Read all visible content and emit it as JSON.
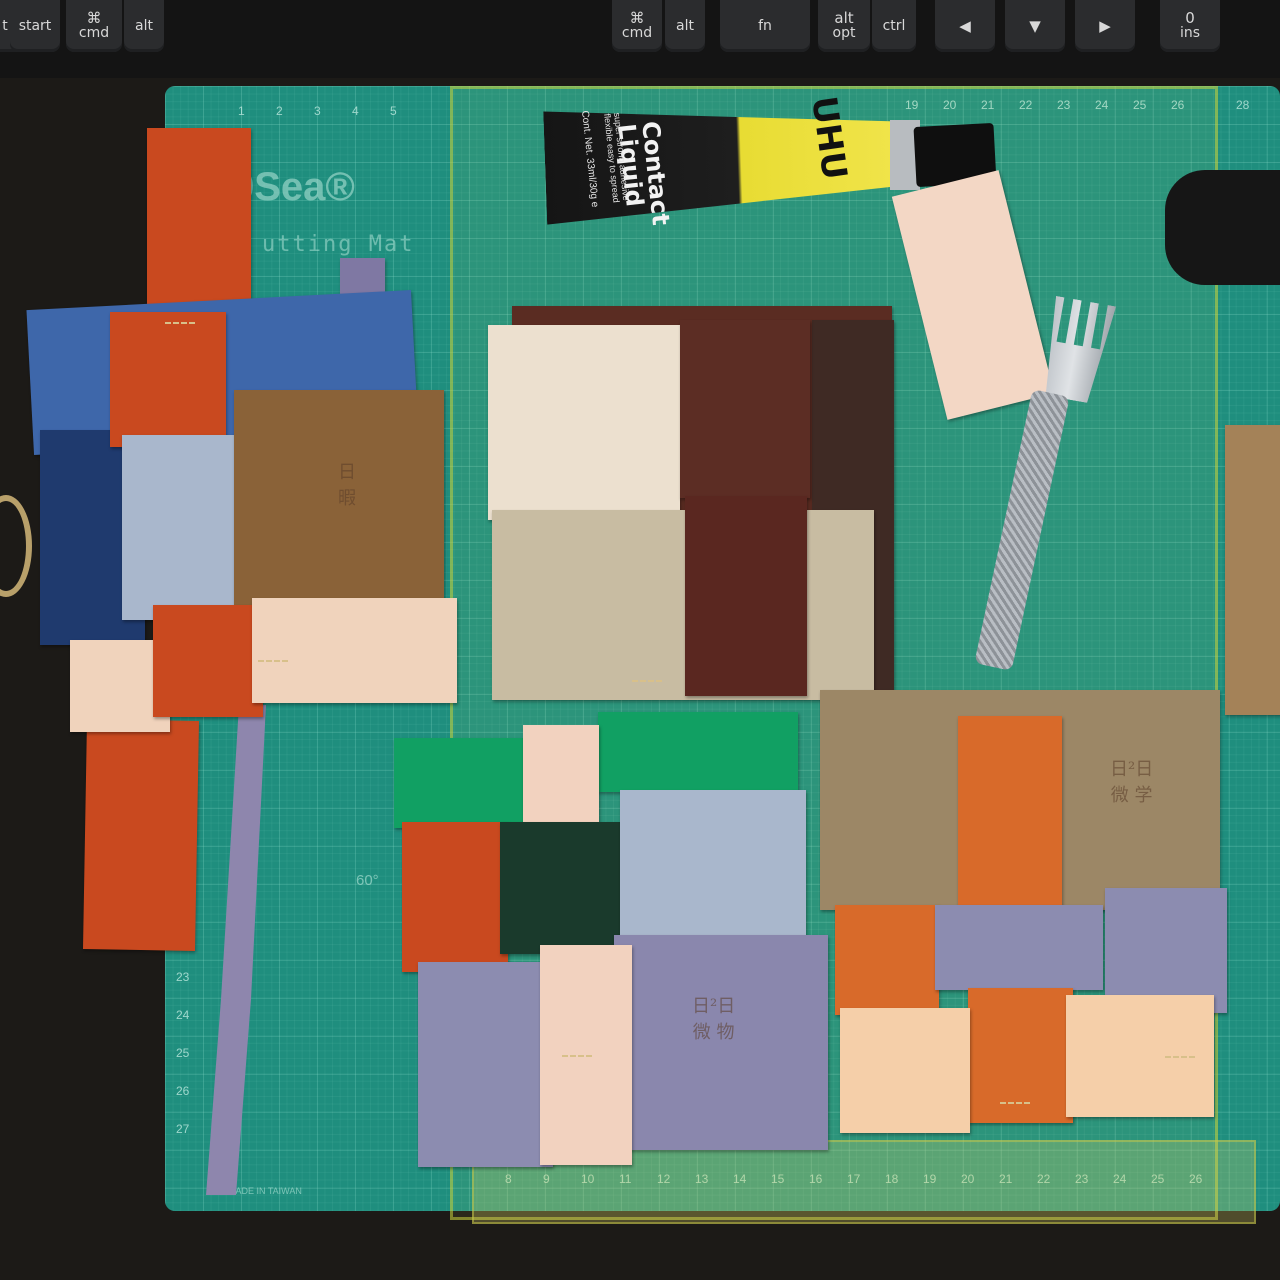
{
  "keyboard": {
    "keys": [
      {
        "id": "key-cut-left",
        "glyph": "",
        "label": "t"
      },
      {
        "id": "key-start",
        "glyph": "",
        "label": "start"
      },
      {
        "id": "key-cmd-left",
        "glyph": "⌘",
        "label": "cmd"
      },
      {
        "id": "key-alt-left",
        "glyph": "",
        "label": "alt"
      },
      {
        "id": "key-cmd-right",
        "glyph": "⌘",
        "label": "cmd"
      },
      {
        "id": "key-alt-right",
        "glyph": "",
        "label": "alt"
      },
      {
        "id": "key-fn",
        "glyph": "",
        "label": "fn"
      },
      {
        "id": "key-alt-opt",
        "glyph": "alt",
        "label": "opt"
      },
      {
        "id": "key-ctrl",
        "glyph": "",
        "label": "ctrl"
      },
      {
        "id": "key-arrow-left",
        "glyph": "◀",
        "label": ""
      },
      {
        "id": "key-arrow-down",
        "glyph": "▼",
        "label": ""
      },
      {
        "id": "key-arrow-right",
        "glyph": "▶",
        "label": ""
      },
      {
        "id": "key-ins",
        "glyph": "0",
        "label": "ins"
      }
    ]
  },
  "mat": {
    "brand": "9Sea®",
    "subtitle": "utting Mat",
    "country": "MADE IN TAIWAN",
    "angle": "60°",
    "top_ruler": [
      "19",
      "20",
      "21",
      "22",
      "23",
      "24",
      "25",
      "26",
      "28"
    ],
    "bottom_ruler": [
      "8",
      "9",
      "10",
      "11",
      "12",
      "13",
      "14",
      "15",
      "16",
      "17",
      "18",
      "19",
      "20",
      "21",
      "22",
      "23",
      "24",
      "25",
      "26"
    ],
    "left_top_ruler": [
      "1",
      "2",
      "3",
      "4",
      "5"
    ],
    "left_side_ruler": [
      "23",
      "24",
      "25",
      "26",
      "27"
    ]
  },
  "glue": {
    "brand": "UHU",
    "product": "Contact Liquid",
    "features": "super strong adhesive flexible easy to spread",
    "content": "Cont. Net. 33ml/30g e"
  },
  "stamps": {
    "brown_left": "日\n暇",
    "lavender_bottom": "日²日\n微 物",
    "tan_right": "日²日\n微 学"
  },
  "colors": {
    "mat": "#1f8e7e",
    "orange_leather": "#c9491f",
    "blue_leather": "#3e67aa",
    "navy_leather": "#1f3a6e",
    "brown_leather": "#8a6238",
    "cream_leather": "#f0d3bc",
    "dark_brown_leather": "#5a2c22",
    "beige_textured": "#c8bca2",
    "green_leather": "#11a063",
    "forest_green": "#1a3a2c",
    "lavender": "#8c8cb0",
    "pale_blue": "#a9b7cc",
    "tan": "#9c8766",
    "tangerine": "#d86a2a",
    "peach": "#f5cfa9"
  }
}
